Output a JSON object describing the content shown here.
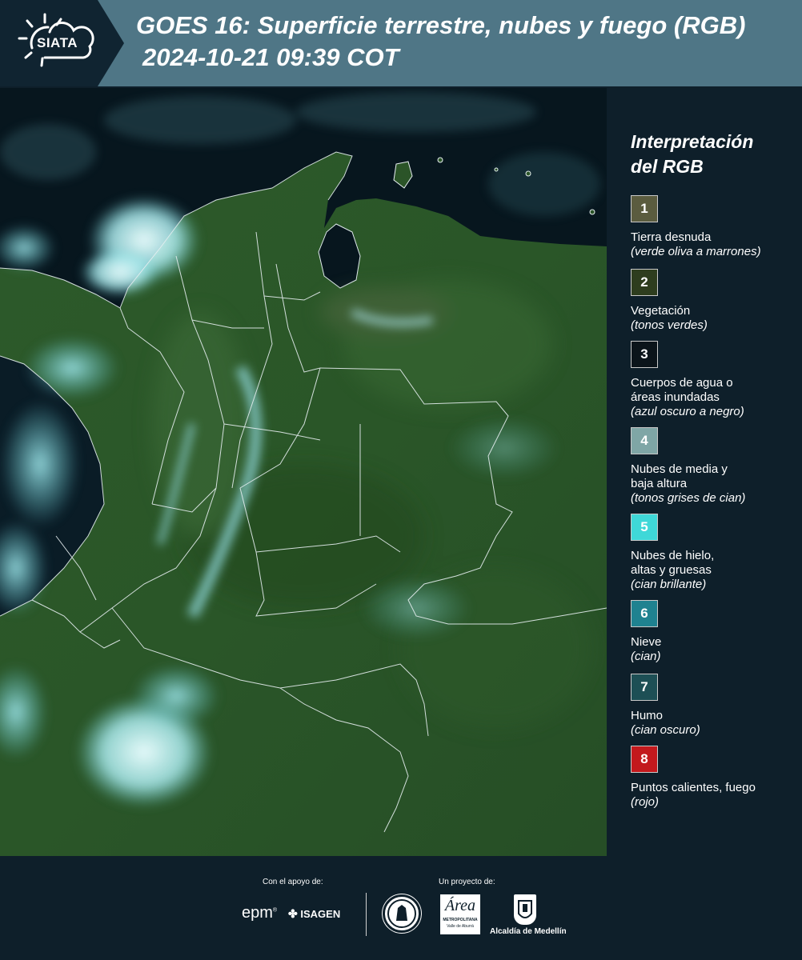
{
  "header": {
    "logo_text": "SIATA",
    "title_line1": "GOES 16: Superficie terrestre, nubes y fuego (RGB)",
    "title_line2": "2024-10-21 09:39 COT"
  },
  "legend": {
    "title_line1": "Interpretación",
    "title_line2": "del RGB",
    "items": [
      {
        "number": "1",
        "color": "#5b5c3f",
        "label_lines": [
          "Tierra desnuda"
        ],
        "sub": "(verde oliva a marrones)"
      },
      {
        "number": "2",
        "color": "#2e3d1e",
        "label_lines": [
          "Vegetación"
        ],
        "sub": "(tonos verdes)"
      },
      {
        "number": "3",
        "color": "#0b141a",
        "label_lines": [
          "Cuerpos de agua o",
          "áreas inundadas"
        ],
        "sub": "(azul oscuro a negro)"
      },
      {
        "number": "4",
        "color": "#7fa6a6",
        "label_lines": [
          "Nubes de media y",
          "baja altura"
        ],
        "sub": "(tonos grises de cian)"
      },
      {
        "number": "5",
        "color": "#3fd8d8",
        "label_lines": [
          "Nubes de hielo,",
          "altas y gruesas"
        ],
        "sub": "(cian brillante)"
      },
      {
        "number": "6",
        "color": "#1f8290",
        "label_lines": [
          "Nieve"
        ],
        "sub": "(cian)"
      },
      {
        "number": "7",
        "color": "#1d4f55",
        "label_lines": [
          "Humo"
        ],
        "sub": "(cian oscuro)"
      },
      {
        "number": "8",
        "color": "#c3191d",
        "label_lines": [
          "Puntos calientes, fuego"
        ],
        "sub": "(rojo)"
      }
    ]
  },
  "footer": {
    "support_label": "Con el apoyo de:",
    "project_label": "Un proyecto de:",
    "sponsor_epm": "epm",
    "sponsor_isagen": "ISAGEN",
    "area_metropolitana_name": "Área",
    "area_metropolitana_sub": "METROPOLITANA",
    "area_metropolitana_sub2": "Valle de Aburrá",
    "alcaldia": "Alcaldía de Medellín"
  },
  "colors": {
    "header_bg": "#4f7686",
    "page_bg": "#0e1f2a",
    "vegetation": "#2f5a2c",
    "cloud_cyan": "#8fe3e6",
    "ocean": "#07161e"
  }
}
